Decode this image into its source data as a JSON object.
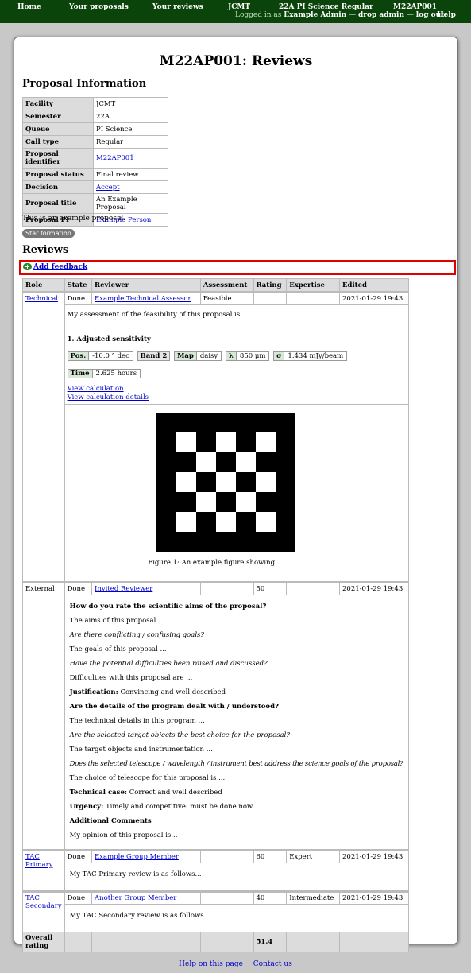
{
  "nav": {
    "home": "Home",
    "proposals": "Your proposals",
    "reviews": "Your reviews",
    "facility": "JCMT",
    "queue": "22A PI Science Regular",
    "code": "M22AP001",
    "help": "Help",
    "logged_in_as": "Logged in as",
    "user": "Example Admin",
    "sep1": "—",
    "drop_admin": "drop admin",
    "sep2": "—",
    "log_out": "log out"
  },
  "page": {
    "title": "M22AP001: Reviews",
    "proposal_heading": "Proposal Information",
    "reviews_heading": "Reviews",
    "abstract": "This is an example proposal.",
    "category": "Star formation",
    "add_feedback": "Add feedback"
  },
  "info": [
    {
      "label": "Facility",
      "value": "JCMT",
      "link": false
    },
    {
      "label": "Semester",
      "value": "22A",
      "link": false
    },
    {
      "label": "Queue",
      "value": "PI Science",
      "link": false
    },
    {
      "label": "Call type",
      "value": "Regular",
      "link": false
    },
    {
      "label": "Proposal identifier",
      "value": "M22AP001",
      "link": true
    },
    {
      "label": "Proposal status",
      "value": "Final review",
      "link": false
    },
    {
      "label": "Decision",
      "value": "Accept",
      "link": true
    },
    {
      "label": "Proposal title",
      "value": "An Example Proposal",
      "link": false
    },
    {
      "label": "Proposal PI",
      "value": "Example Person",
      "link": true
    }
  ],
  "reviews_table": {
    "headers": {
      "role": "Role",
      "state": "State",
      "reviewer": "Reviewer",
      "assessment": "Assessment",
      "rating": "Rating",
      "expertise": "Expertise",
      "edited": "Edited"
    },
    "technical": {
      "role": "Technical",
      "state": "Done",
      "reviewer": "Example Technical Assessor",
      "assessment": "Feasible",
      "rating": "",
      "expertise": "",
      "edited": "2021-01-29 19:43",
      "text": "My assessment of the feasibility of this proposal is...",
      "calc_title": "1. Adjusted sensitivity",
      "calc": {
        "pos_k": "Pos.",
        "pos_v": "-10.0 ° dec",
        "band_k": "Band 2",
        "map_k": "Map",
        "map_v": "daisy",
        "lambda_k": "λ",
        "lambda_v": "850 µm",
        "sigma_k": "σ",
        "sigma_v": "1.434 mJy/beam",
        "time_k": "Time",
        "time_v": "2.625 hours"
      },
      "view_calc": "View calculation",
      "view_calc_details": "View calculation details",
      "figure_caption": "Figure 1: An example figure showing ..."
    },
    "external": {
      "role": "External",
      "state": "Done",
      "reviewer": "Invited Reviewer",
      "assessment": "",
      "rating": "50",
      "expertise": "",
      "edited": "2021-01-29 19:43",
      "q1": "How do you rate the scientific aims of the proposal?",
      "l1": "The aims of this proposal ...",
      "l2": "Are there conflicting / confusing goals?",
      "l3": "The goals of this proposal ...",
      "l4": "Have the potential difficulties been raised and discussed?",
      "l5": "Difficulties with this proposal are ...",
      "just_k": "Justification:",
      "just_v": "Convincing and well described",
      "q2": "Are the details of the program dealt with / understood?",
      "l6": "The technical details in this program ...",
      "l7": "Are the selected target objects the best choice for the proposal?",
      "l8": "The target objects and instrumentation ...",
      "l9": "Does the selected telescope / wavelength / instrument best address the science goals of the proposal?",
      "l10": "The choice of telescope for this proposal is ...",
      "tech_k": "Technical case:",
      "tech_v": "Correct and well described",
      "urg_k": "Urgency:",
      "urg_v": "Timely and competitive: must be done now",
      "add_h": "Additional Comments",
      "l11": "My opinion of this proposal is..."
    },
    "tac_primary": {
      "role": "TAC Primary",
      "state": "Done",
      "reviewer": "Example Group Member",
      "assessment": "",
      "rating": "60",
      "expertise": "Expert",
      "edited": "2021-01-29 19:43",
      "text": "My TAC Primary review is as follows..."
    },
    "tac_secondary": {
      "role": "TAC Secondary",
      "state": "Done",
      "reviewer": "Another Group Member",
      "assessment": "",
      "rating": "40",
      "expertise": "Intermediate",
      "edited": "2021-01-29 19:43",
      "text": "My TAC Secondary review is as follows..."
    },
    "overall_label": "Overall rating",
    "overall_value": "51.4"
  },
  "footer": {
    "help": "Help on this page",
    "contact": "Contact us"
  }
}
